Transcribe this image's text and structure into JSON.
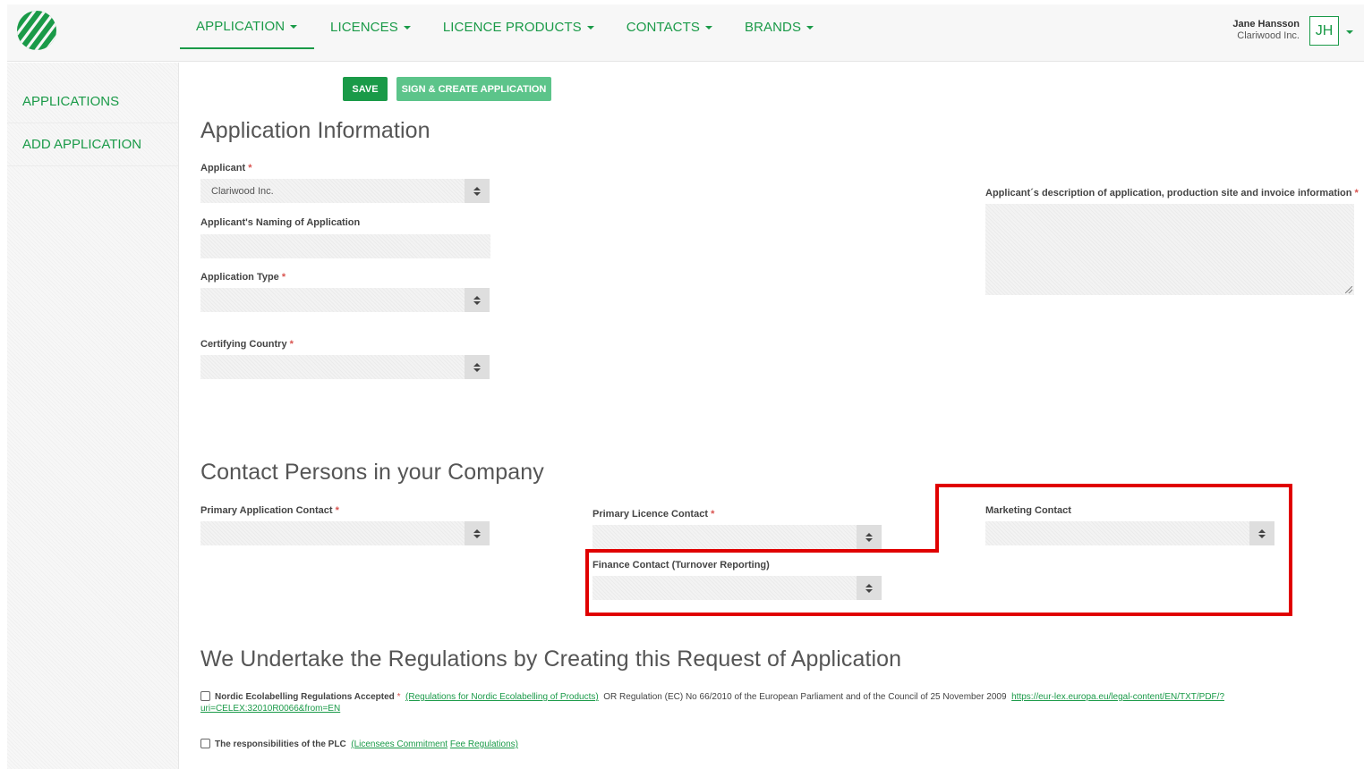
{
  "nav": {
    "items": [
      {
        "label": "APPLICATION"
      },
      {
        "label": "LICENCES"
      },
      {
        "label": "LICENCE PRODUCTS"
      },
      {
        "label": "CONTACTS"
      },
      {
        "label": "BRANDS"
      }
    ]
  },
  "user": {
    "name": "Jane Hansson",
    "org": "Clariwood Inc.",
    "initials": "JH"
  },
  "sidebar": {
    "items": [
      {
        "label": "APPLICATIONS"
      },
      {
        "label": "ADD APPLICATION"
      }
    ]
  },
  "toolbar": {
    "save_label": "SAVE",
    "sign_label": "SIGN & CREATE APPLICATION"
  },
  "app_info": {
    "heading": "Application Information",
    "applicant_label": "Applicant",
    "applicant_value": "Clariwood Inc.",
    "naming_label": "Applicant's Naming of Application",
    "type_label": "Application Type",
    "country_label": "Certifying Country",
    "description_label": "Applicant´s description of application, production site and invoice information"
  },
  "contacts": {
    "heading": "Contact Persons in your Company",
    "primary_app_label": "Primary Application Contact",
    "primary_licence_label": "Primary Licence Contact",
    "marketing_label": "Marketing Contact",
    "finance_label": "Finance Contact (Turnover Reporting)"
  },
  "regulations": {
    "heading": "We Undertake the Regulations by Creating this Request of Application",
    "row1_label": "Nordic Ecolabelling Regulations Accepted",
    "row1_link1": "(Regulations for Nordic Ecolabelling of Products)",
    "row1_text": "OR Regulation (EC) No 66/2010 of the European Parliament and of the Council of 25 November 2009",
    "row1_link2a": "https://eur-lex.europa.eu/legal-content/EN/TXT/PDF/?",
    "row1_link2b": "uri=CELEX:32010R0066&from=EN",
    "row2_label": "The responsibilities of the PLC",
    "row2_link1": "(Licensees Commitment",
    "row2_link2": "Fee Regulations)"
  },
  "required_marker": "*",
  "colors": {
    "brand_green": "#1a9a48",
    "light_green": "#5cc48a",
    "highlight_red": "#e00000"
  }
}
